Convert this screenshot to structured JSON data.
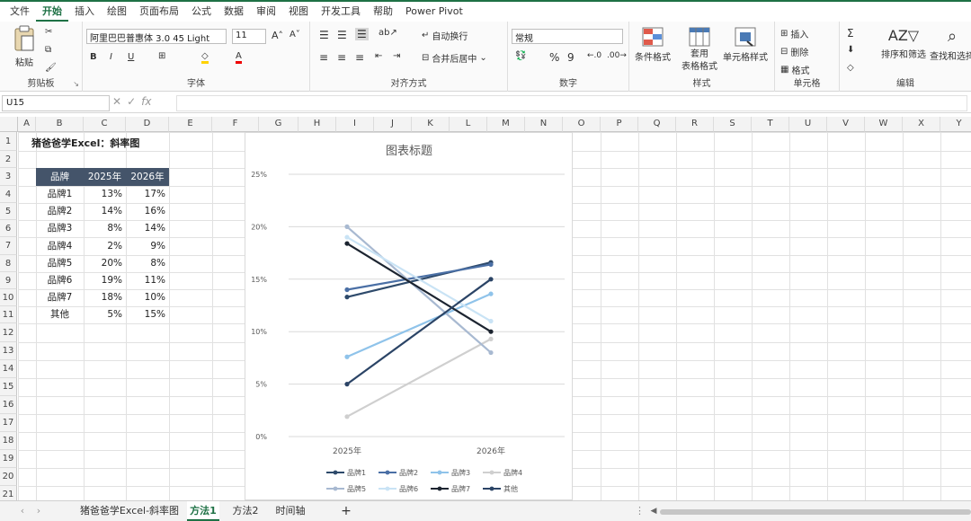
{
  "menu": [
    "文件",
    "开始",
    "插入",
    "绘图",
    "页面布局",
    "公式",
    "数据",
    "审阅",
    "视图",
    "开发工具",
    "帮助",
    "Power Pivot"
  ],
  "ribbon": {
    "clipboard": {
      "label": "剪贴板",
      "paste": "粘贴"
    },
    "font": {
      "label": "字体",
      "name": "阿里巴巴普惠体 3.0 45 Light",
      "size": "11",
      "bold": "B",
      "italic": "I",
      "underline": "U"
    },
    "align": {
      "label": "对齐方式",
      "wrap": "自动换行",
      "merge": "合并后居中"
    },
    "number": {
      "label": "数字",
      "format": "常规"
    },
    "styles": {
      "label": "样式",
      "cond": "条件格式",
      "table1": "套用",
      "table2": "表格格式",
      "cellstyle": "单元格样式"
    },
    "cells": {
      "label": "单元格",
      "insert": "插入",
      "delete": "删除",
      "format": "格式"
    },
    "edit": {
      "label": "编辑",
      "sort": "排序和筛选",
      "find": "查找和选择"
    }
  },
  "formula": {
    "namebox": "U15",
    "fx": "fx"
  },
  "columns": [
    "A",
    "B",
    "C",
    "D",
    "E",
    "F",
    "G",
    "H",
    "I",
    "J",
    "K",
    "L",
    "M",
    "N",
    "O",
    "P",
    "Q",
    "R",
    "S",
    "T",
    "U",
    "V",
    "W",
    "X",
    "Y"
  ],
  "rows": [
    "1",
    "2",
    "3",
    "4",
    "5",
    "6",
    "7",
    "8",
    "9",
    "10",
    "11",
    "12",
    "13",
    "14",
    "15",
    "16",
    "17",
    "18",
    "19",
    "20",
    "21"
  ],
  "sheet": {
    "title": "猪爸爸学Excel：斜率图",
    "headers": [
      "品牌",
      "2025年",
      "2026年"
    ],
    "data": [
      [
        "品牌1",
        "13%",
        "17%"
      ],
      [
        "品牌2",
        "14%",
        "16%"
      ],
      [
        "品牌3",
        "8%",
        "14%"
      ],
      [
        "品牌4",
        "2%",
        "9%"
      ],
      [
        "品牌5",
        "20%",
        "8%"
      ],
      [
        "品牌6",
        "19%",
        "11%"
      ],
      [
        "品牌7",
        "18%",
        "10%"
      ],
      [
        "其他",
        "5%",
        "15%"
      ]
    ]
  },
  "chart_data": {
    "type": "line",
    "title": "图表标题",
    "categories": [
      "2025年",
      "2026年"
    ],
    "ylim": [
      0,
      25
    ],
    "yticks": [
      "0%",
      "5%",
      "10%",
      "15%",
      "20%",
      "25%"
    ],
    "grid": true,
    "legend": "bottom",
    "series": [
      {
        "name": "品牌1",
        "values": [
          13.3,
          16.6
        ],
        "color": "#2e4a6b"
      },
      {
        "name": "品牌2",
        "values": [
          14,
          16.4
        ],
        "color": "#4a6fa5"
      },
      {
        "name": "品牌3",
        "values": [
          7.6,
          13.6
        ],
        "color": "#8fc3ea"
      },
      {
        "name": "品牌4",
        "values": [
          1.9,
          9.3
        ],
        "color": "#cfcfcf"
      },
      {
        "name": "品牌5",
        "values": [
          20,
          8
        ],
        "color": "#a8b9d1"
      },
      {
        "name": "品牌6",
        "values": [
          19,
          11
        ],
        "color": "#c9e3f5"
      },
      {
        "name": "品牌7",
        "values": [
          18.4,
          10
        ],
        "color": "#1c2430"
      },
      {
        "name": "其他",
        "values": [
          5,
          15
        ],
        "color": "#2b4466"
      }
    ]
  },
  "tabs": [
    "猪爸爸学Excel-斜率图",
    "方法1",
    "方法2",
    "时间轴"
  ],
  "tabs_active": "方法1",
  "add_sheet": "+"
}
